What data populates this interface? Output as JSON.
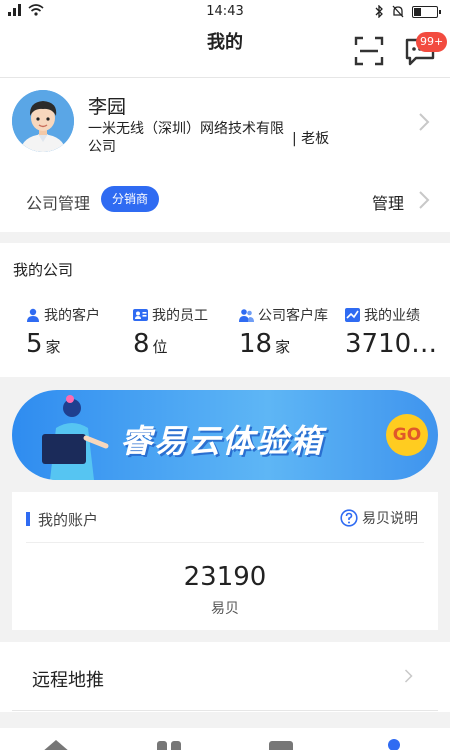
{
  "status_bar": {
    "time": "14:43"
  },
  "header": {
    "title": "我的",
    "message_badge": "99+"
  },
  "profile": {
    "name": "李园",
    "company": "一米无线（深圳）网络技术有限公司",
    "role": "| 老板",
    "management_label": "公司管理",
    "tag": "分销商",
    "management_link": "管理"
  },
  "my_company": {
    "heading": "我的公司",
    "stats": [
      {
        "label": "我的客户",
        "value": "5",
        "unit": "家"
      },
      {
        "label": "我的员工",
        "value": "8",
        "unit": "位"
      },
      {
        "label": "公司客户库",
        "value": "18",
        "unit": "家"
      },
      {
        "label": "我的业绩",
        "value": "3710…",
        "unit": ""
      }
    ]
  },
  "banner": {
    "text": "睿易云体验箱",
    "button": "GO"
  },
  "account": {
    "title": "我的账户",
    "help": "易贝说明",
    "value": "23190",
    "unit": "易贝"
  },
  "remote": {
    "label": "远程地推"
  },
  "colors": {
    "accent": "#2f6bf2",
    "badge": "#f24b3f",
    "banner": "#3f94ee"
  }
}
